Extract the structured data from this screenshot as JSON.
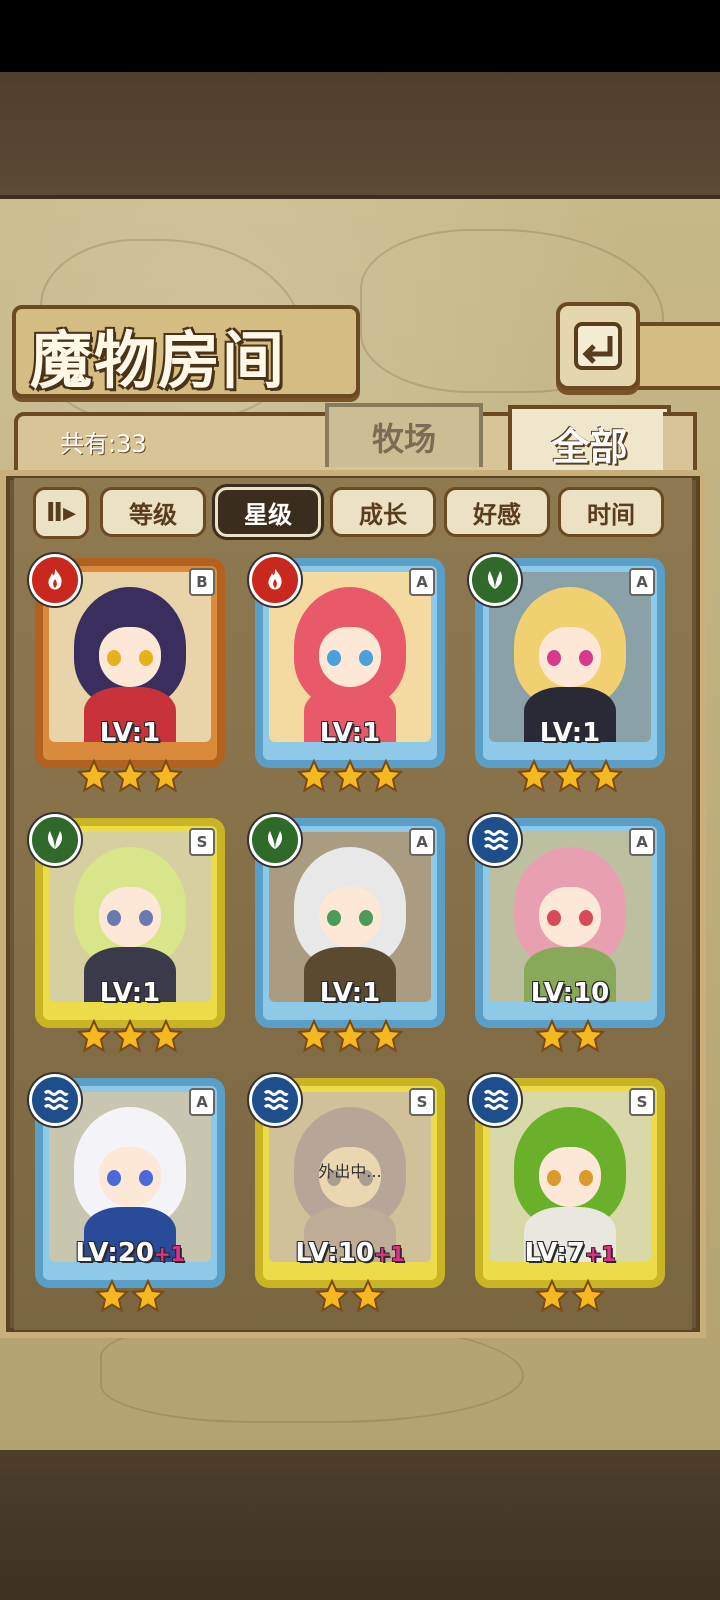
{
  "header": {
    "title": "魔物房间",
    "count_label": "共有:33"
  },
  "tabs": {
    "ranch": "牧场",
    "all": "全部"
  },
  "filters": {
    "toggle": "Ⅱ▸",
    "items": [
      "等级",
      "星级",
      "成长",
      "好感",
      "时间"
    ],
    "active": "星级"
  },
  "monsters": [
    {
      "level": "LV:1",
      "plus": "",
      "rank": "B",
      "element": "fire-icon",
      "stars": 3,
      "frame": "copper",
      "away": ""
    },
    {
      "level": "LV:1",
      "plus": "",
      "rank": "A",
      "element": "fire-icon",
      "stars": 3,
      "frame": "blue",
      "away": ""
    },
    {
      "level": "LV:1",
      "plus": "",
      "rank": "A",
      "element": "leaf-icon",
      "stars": 3,
      "frame": "blue",
      "away": ""
    },
    {
      "level": "LV:1",
      "plus": "",
      "rank": "S",
      "element": "leaf-icon",
      "stars": 3,
      "frame": "gold",
      "away": ""
    },
    {
      "level": "LV:1",
      "plus": "",
      "rank": "A",
      "element": "leaf-icon",
      "stars": 3,
      "frame": "blue",
      "away": ""
    },
    {
      "level": "LV:10",
      "plus": "",
      "rank": "A",
      "element": "water-icon",
      "stars": 2,
      "frame": "blue",
      "away": ""
    },
    {
      "level": "LV:20",
      "plus": "+1",
      "rank": "A",
      "element": "water-icon",
      "stars": 2,
      "frame": "blue",
      "away": ""
    },
    {
      "level": "LV:10",
      "plus": "+1",
      "rank": "S",
      "element": "water-icon",
      "stars": 2,
      "frame": "gold",
      "away": "外出中..."
    },
    {
      "level": "LV:7",
      "plus": "+1",
      "rank": "S",
      "element": "water-icon",
      "stars": 2,
      "frame": "gold",
      "away": ""
    }
  ],
  "colors": {
    "fire": "#c8281e",
    "leaf": "#2f6a2a",
    "water": "#1e4e8c",
    "star": "#f5b820"
  }
}
